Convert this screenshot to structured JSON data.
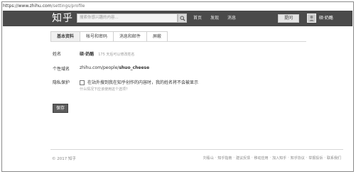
{
  "browser": {
    "url_prefix": "https://",
    "url_host": "www.zhihu.com",
    "url_path": "/settings/profile"
  },
  "header": {
    "logo": "知乎",
    "search_placeholder": "搜索你感兴趣的内容...",
    "nav_links": [
      "首页",
      "发现",
      "消息"
    ],
    "ask_button": "提问",
    "username": "硕·奶酪"
  },
  "tabs": [
    {
      "label": "基本资料",
      "active": true
    },
    {
      "label": "帐号和密码",
      "active": false
    },
    {
      "label": "消息和邮件",
      "active": false
    },
    {
      "label": "屏蔽",
      "active": false
    }
  ],
  "form": {
    "name_label": "姓名",
    "name_value": "硕·奶酪",
    "name_hint": "175 天后可以修改姓名",
    "domain_label": "个性域名",
    "domain_prefix": "zhihu.com/people/",
    "domain_value": "shuo_cheese",
    "privacy_label": "隐私保护",
    "privacy_option": "在站外搜到我在知乎创作的内容时，我的姓名将不会被显示",
    "privacy_link": "什么情况下应该使用这个选项？",
    "save_button": "保存"
  },
  "footer": {
    "copyright": "© 2017 知乎",
    "links": [
      "刘看山",
      "知乎指南",
      "建议反馈",
      "移动应用",
      "加入知乎",
      "知乎协议",
      "举报投诉",
      "联系我们"
    ]
  },
  "colors": {
    "nav_bg": "#4a4a4a",
    "save_bg": "#5d5d5d"
  }
}
